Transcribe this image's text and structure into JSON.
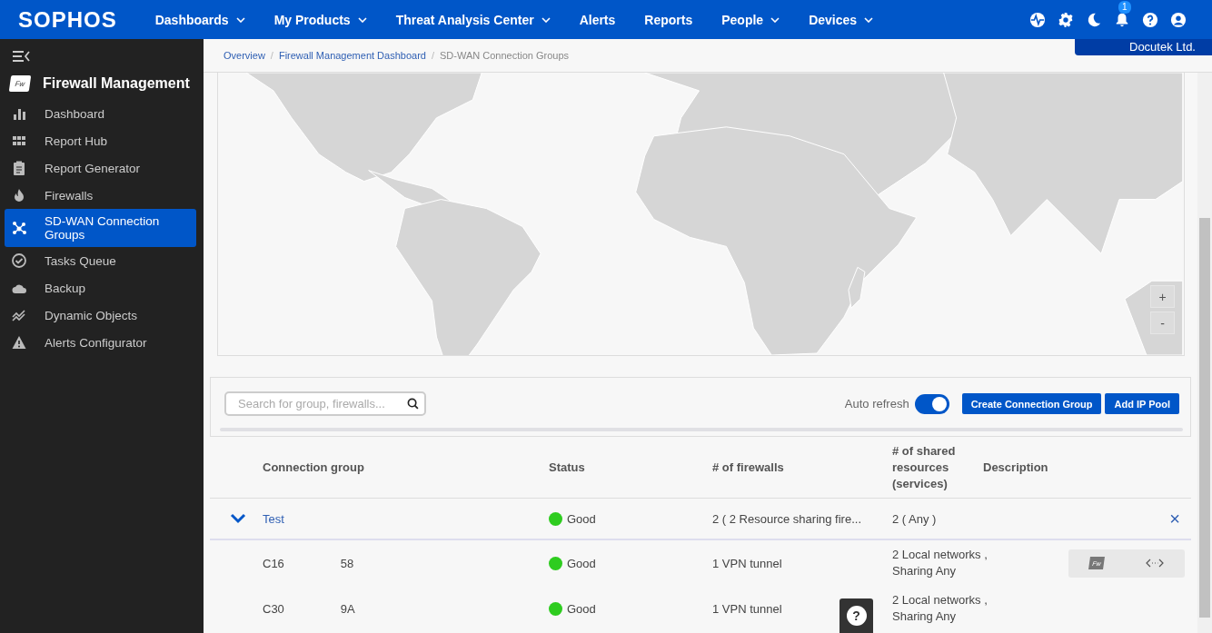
{
  "topbar": {
    "logo": "SOPHOS",
    "nav": [
      {
        "label": "Dashboards",
        "dropdown": true
      },
      {
        "label": "My Products",
        "dropdown": true
      },
      {
        "label": "Threat Analysis Center",
        "dropdown": true
      },
      {
        "label": "Alerts",
        "dropdown": false
      },
      {
        "label": "Reports",
        "dropdown": false
      },
      {
        "label": "People",
        "dropdown": true
      },
      {
        "label": "Devices",
        "dropdown": true
      }
    ],
    "notification_count": "1",
    "tenant": "Docutek Ltd."
  },
  "sidebar": {
    "product_badge": "Fw",
    "product": "Firewall Management",
    "items": [
      {
        "label": "Dashboard",
        "selected": false
      },
      {
        "label": "Report Hub",
        "selected": false
      },
      {
        "label": "Report Generator",
        "selected": false
      },
      {
        "label": "Firewalls",
        "selected": false
      },
      {
        "label": "SD-WAN Connection Groups",
        "selected": true
      },
      {
        "label": "Tasks Queue",
        "selected": false
      },
      {
        "label": "Backup",
        "selected": false
      },
      {
        "label": "Dynamic Objects",
        "selected": false
      },
      {
        "label": "Alerts Configurator",
        "selected": false
      }
    ]
  },
  "breadcrumbs": [
    {
      "label": "Overview",
      "link": true
    },
    {
      "separator": "/",
      "label": "Firewall Management Dashboard",
      "link": true
    },
    {
      "separator": "/",
      "label": "SD-WAN Connection Groups",
      "link": false
    }
  ],
  "map": {
    "zoom_in": "+",
    "zoom_out": "-"
  },
  "toolbar": {
    "search": {
      "placeholder": "Search for group, firewalls..."
    },
    "auto_refresh": {
      "label": "Auto refresh",
      "on": true
    },
    "buttons": [
      "Create Connection Group",
      "Add IP Pool"
    ]
  },
  "table": {
    "columns": [
      "Connection group",
      "Status",
      "# of firewalls",
      "# of shared resources (services)",
      "Description"
    ],
    "group": {
      "name": "Test",
      "expanded": true,
      "status": {
        "label": "Good",
        "color": "#2ecc1f"
      },
      "firewalls": "2 ( 2 Resource sharing fire...",
      "resources": "2 ( Any )",
      "remove": "×"
    },
    "rows": [
      {
        "name_start": "C16",
        "name_end": "58",
        "status": {
          "label": "Good",
          "color": "#2ecc1f"
        },
        "firewalls": "1 VPN tunnel",
        "resources": [
          "2 Local networks ,",
          "Sharing Any"
        ],
        "actions": {
          "badge": "Fw"
        }
      },
      {
        "name_start": "C30",
        "name_end": "9A",
        "status": {
          "label": "Good",
          "color": "#2ecc1f"
        },
        "firewalls": "1 VPN tunnel",
        "resources": [
          "2 Local networks ,",
          "Sharing Any"
        ]
      }
    ]
  },
  "help": "?"
}
